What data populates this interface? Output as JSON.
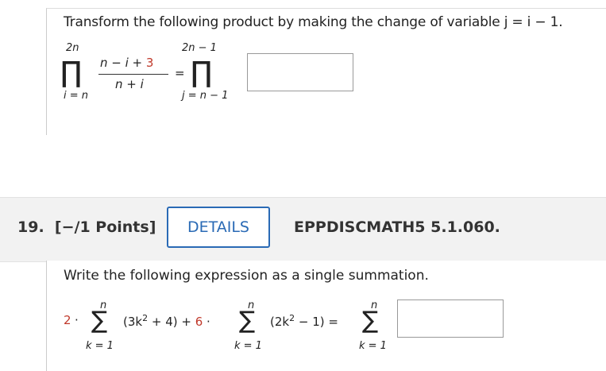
{
  "q18": {
    "prompt": "Transform the following product by making the change of variable j = i − 1.",
    "upper1": "2n",
    "lower1": "i = n",
    "frac_num_black": "n − i + ",
    "frac_num_red": "3",
    "frac_den": "n + i",
    "equals": "=",
    "upper2": "2n − 1",
    "lower2": "j = n − 1",
    "pi_symbol": "∏"
  },
  "q19": {
    "number": "19.",
    "points": "[−/1 Points]",
    "details_label": "DETAILS",
    "code": "EPPDISCMATH5 5.1.060.",
    "prompt": "Write the following expression as a single summation.",
    "coef1": "2",
    "dot": "·",
    "sigma_symbol": "∑",
    "term1_a": "(3k",
    "term1_sup": "2",
    "term1_b": " + 4) + ",
    "coef2": "6",
    "term2_a": "(2k",
    "term2_sup": "2",
    "term2_b": " − 1) =",
    "sum_upper": "n",
    "sum_lower": "k = 1"
  }
}
